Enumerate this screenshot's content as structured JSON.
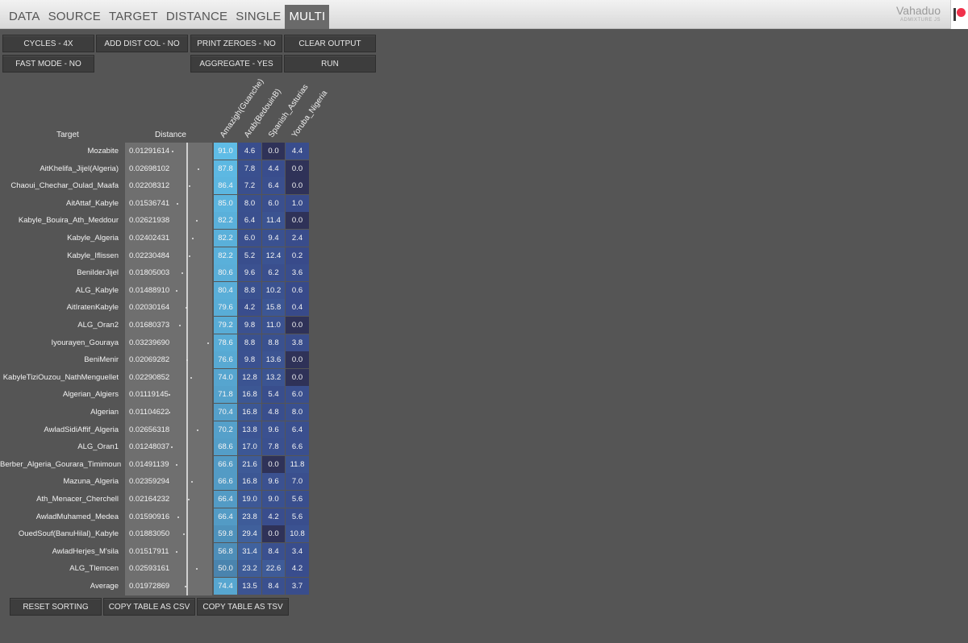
{
  "nav": {
    "tabs": [
      "DATA",
      "SOURCE",
      "TARGET",
      "DISTANCE",
      "SINGLE",
      "MULTI"
    ],
    "active": "MULTI"
  },
  "brand": {
    "name": "Vahaduo",
    "sub": "ADMIXTURE JS"
  },
  "controls": {
    "cycles": "CYCLES - 4X",
    "add_dist_col": "ADD DIST COL - NO",
    "print_zeroes": "PRINT ZEROES - NO",
    "clear_output": "CLEAR OUTPUT",
    "fast_mode": "FAST MODE - NO",
    "aggregate": "AGGREGATE - YES",
    "run": "RUN"
  },
  "table": {
    "header_target": "Target",
    "header_distance": "Distance",
    "sources": [
      "Amazigh(Guanche)",
      "Arab(BedouinB)",
      "Spanish_Asturias",
      "Yoruba_Nigeria"
    ],
    "rows": [
      {
        "target": "Mozabite",
        "distance": "0.01291614",
        "values": [
          "91.0",
          "4.6",
          "0.0",
          "4.4"
        ]
      },
      {
        "target": "AitKhelifa_Jijel(Algeria)",
        "distance": "0.02698102",
        "values": [
          "87.8",
          "7.8",
          "4.4",
          "0.0"
        ]
      },
      {
        "target": "Chaoui_Chechar_Oulad_Maafa",
        "distance": "0.02208312",
        "values": [
          "86.4",
          "7.2",
          "6.4",
          "0.0"
        ]
      },
      {
        "target": "AitAttaf_Kabyle",
        "distance": "0.01536741",
        "values": [
          "85.0",
          "8.0",
          "6.0",
          "1.0"
        ]
      },
      {
        "target": "Kabyle_Bouira_Ath_Meddour",
        "distance": "0.02621938",
        "values": [
          "82.2",
          "6.4",
          "11.4",
          "0.0"
        ]
      },
      {
        "target": "Kabyle_Algeria",
        "distance": "0.02402431",
        "values": [
          "82.2",
          "6.0",
          "9.4",
          "2.4"
        ]
      },
      {
        "target": "Kabyle_Iflissen",
        "distance": "0.02230484",
        "values": [
          "82.2",
          "5.2",
          "12.4",
          "0.2"
        ]
      },
      {
        "target": "BeniIderJijel",
        "distance": "0.01805003",
        "values": [
          "80.6",
          "9.6",
          "6.2",
          "3.6"
        ]
      },
      {
        "target": "ALG_Kabyle",
        "distance": "0.01488910",
        "values": [
          "80.4",
          "8.8",
          "10.2",
          "0.6"
        ]
      },
      {
        "target": "AitIratenKabyle",
        "distance": "0.02030164",
        "values": [
          "79.6",
          "4.2",
          "15.8",
          "0.4"
        ]
      },
      {
        "target": "ALG_Oran2",
        "distance": "0.01680373",
        "values": [
          "79.2",
          "9.8",
          "11.0",
          "0.0"
        ]
      },
      {
        "target": "Iyourayen_Gouraya",
        "distance": "0.03239690",
        "values": [
          "78.6",
          "8.8",
          "8.8",
          "3.8"
        ]
      },
      {
        "target": "BeniMenir",
        "distance": "0.02069282",
        "values": [
          "76.6",
          "9.8",
          "13.6",
          "0.0"
        ]
      },
      {
        "target": "KabyleTiziOuzou_NathMenguellet",
        "distance": "0.02290852",
        "values": [
          "74.0",
          "12.8",
          "13.2",
          "0.0"
        ]
      },
      {
        "target": "Algerian_Algiers",
        "distance": "0.01119145",
        "values": [
          "71.8",
          "16.8",
          "5.4",
          "6.0"
        ]
      },
      {
        "target": "Algerian",
        "distance": "0.01104622",
        "values": [
          "70.4",
          "16.8",
          "4.8",
          "8.0"
        ]
      },
      {
        "target": "AwladSidiAffif_Algeria",
        "distance": "0.02656318",
        "values": [
          "70.2",
          "13.8",
          "9.6",
          "6.4"
        ]
      },
      {
        "target": "ALG_Oran1",
        "distance": "0.01248037",
        "values": [
          "68.6",
          "17.0",
          "7.8",
          "6.6"
        ]
      },
      {
        "target": "Berber_Algeria_Gourara_Timimoun",
        "distance": "0.01491139",
        "values": [
          "66.6",
          "21.6",
          "0.0",
          "11.8"
        ]
      },
      {
        "target": "Mazuna_Algeria",
        "distance": "0.02359294",
        "values": [
          "66.6",
          "16.8",
          "9.6",
          "7.0"
        ]
      },
      {
        "target": "Ath_Menacer_Cherchell",
        "distance": "0.02164232",
        "values": [
          "66.4",
          "19.0",
          "9.0",
          "5.6"
        ]
      },
      {
        "target": "AwladMuhamed_Medea",
        "distance": "0.01590916",
        "values": [
          "66.4",
          "23.8",
          "4.2",
          "5.6"
        ]
      },
      {
        "target": "OuedSouf(BanuHilal)_Kabyle",
        "distance": "0.01883050",
        "values": [
          "59.8",
          "29.4",
          "0.0",
          "10.8"
        ]
      },
      {
        "target": "AwladHerjes_M'sila",
        "distance": "0.01517911",
        "values": [
          "56.8",
          "31.4",
          "8.4",
          "3.4"
        ]
      },
      {
        "target": "ALG_Tlemcen",
        "distance": "0.02593161",
        "values": [
          "50.0",
          "23.2",
          "22.6",
          "4.2"
        ]
      },
      {
        "target": "Average",
        "distance": "0.01972869",
        "values": [
          "74.4",
          "13.5",
          "8.4",
          "3.7"
        ]
      }
    ]
  },
  "footer": {
    "reset_sorting": "RESET SORTING",
    "copy_csv": "COPY TABLE AS CSV",
    "copy_tsv": "COPY TABLE AS TSV"
  },
  "colors": {
    "background": "#555555",
    "button": "#3d3d3d",
    "accent_low": "#2e3660",
    "accent_high": "#63c8f2",
    "patreon": "#f0304a"
  }
}
